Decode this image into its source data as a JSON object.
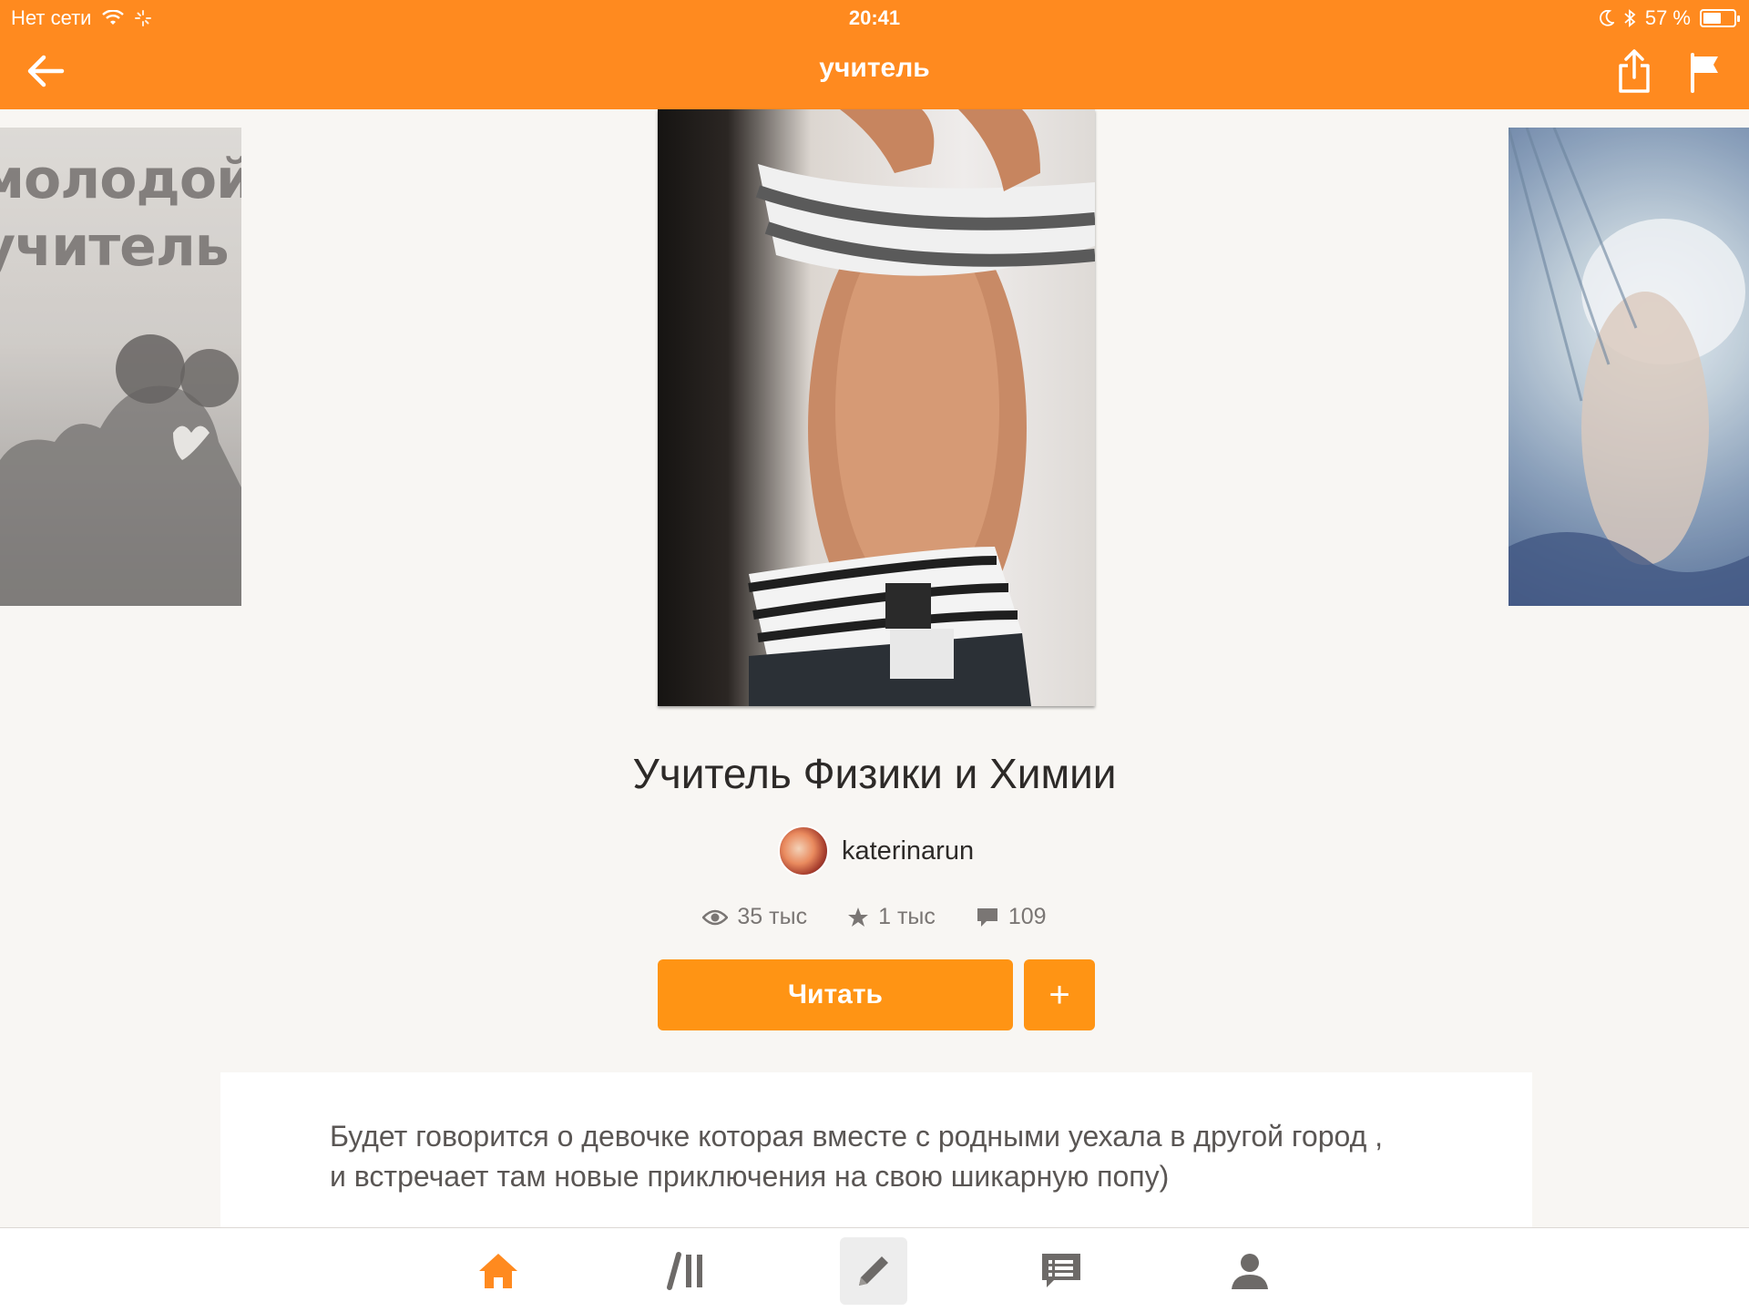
{
  "status_bar": {
    "carrier": "Нет сети",
    "time": "20:41",
    "battery_text": "57 %",
    "battery_level": 0.57
  },
  "nav": {
    "title": "учитель",
    "back_icon": "arrow-left-icon",
    "share_icon": "share-icon",
    "report_icon": "flag-icon"
  },
  "carousel": {
    "left_cover_text": "молодой\nучитель"
  },
  "book": {
    "title": "Учитель Физики и Химии",
    "author": "katerinarun",
    "stats": {
      "reads": "35 тыс",
      "votes": "1 тыс",
      "comments": "109"
    },
    "read_button": "Читать",
    "add_button": "+",
    "description": "Будет говорится о девочке которая вместе с родными уехала в другой город , и встречает там новые приключения на свою шикарную попу)"
  },
  "tabbar": {
    "items": [
      "home-icon",
      "library-icon",
      "write-icon",
      "messages-icon",
      "profile-icon"
    ],
    "active": "home-icon"
  },
  "colors": {
    "brand": "#ff8a1f",
    "button": "#ff9414",
    "active_tab": "#ff8a1f",
    "inactive_tab": "#6d6a68",
    "background": "#f8f6f3"
  }
}
